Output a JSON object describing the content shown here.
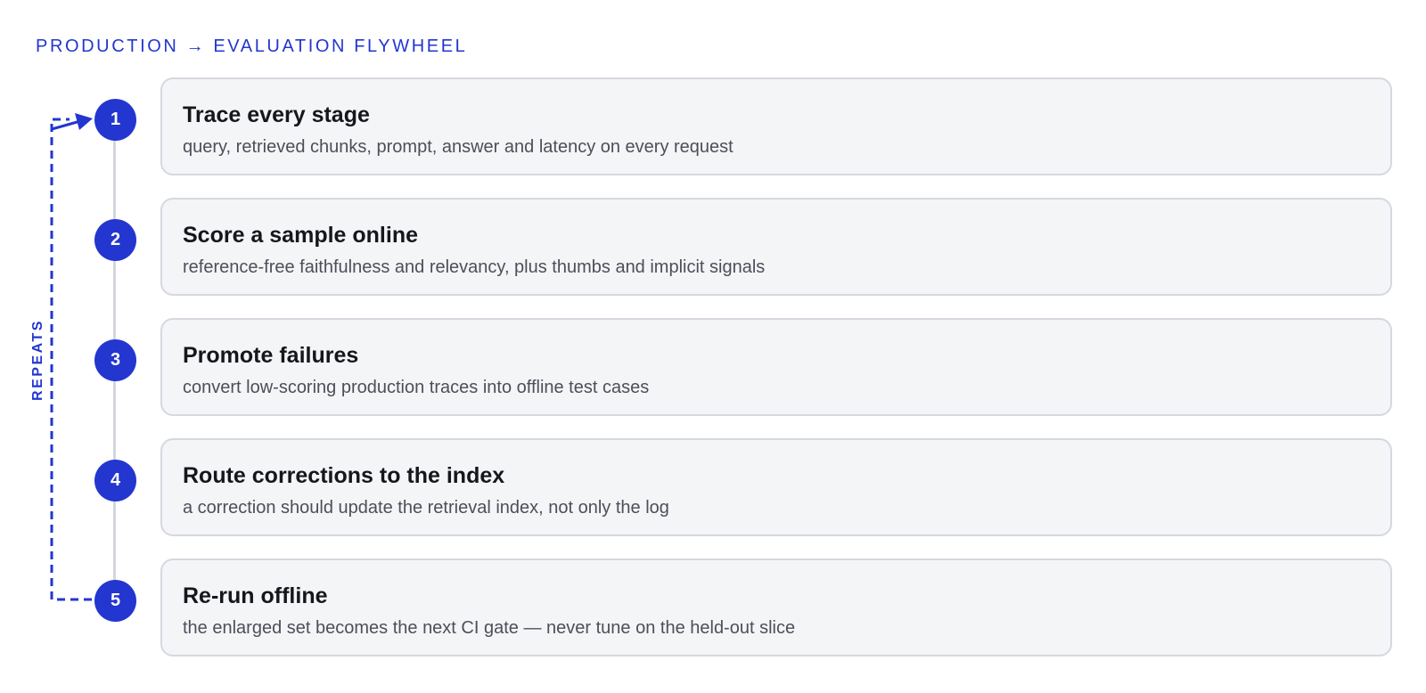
{
  "header": {
    "title": "PRODUCTION → EVALUATION FLYWHEEL"
  },
  "loop": {
    "label": "REPEATS"
  },
  "steps": [
    {
      "number": "1",
      "title": "Trace every stage",
      "description": "query, retrieved chunks, prompt, answer and latency on every request"
    },
    {
      "number": "2",
      "title": "Score a sample online",
      "description": "reference-free faithfulness and relevancy, plus thumbs and implicit signals"
    },
    {
      "number": "3",
      "title": "Promote failures",
      "description": "convert low-scoring production traces into offline test cases"
    },
    {
      "number": "4",
      "title": "Route corrections to the index",
      "description": "a correction should update the retrieval index, not only the log"
    },
    {
      "number": "5",
      "title": "Re-run offline",
      "description": "the enlarged set becomes the next CI gate — never tune on the held-out slice"
    }
  ],
  "colors": {
    "accent": "#2336d0",
    "card_background": "#f4f5f7",
    "card_border": "#d6d8df",
    "rail": "#d4d6de",
    "title_text": "#16171c",
    "description_text": "#4c4f59"
  }
}
